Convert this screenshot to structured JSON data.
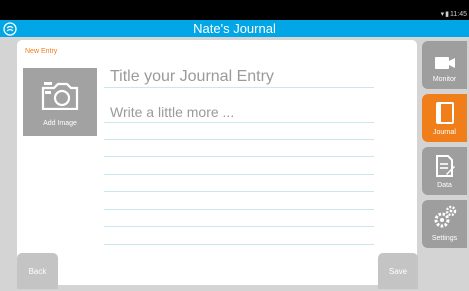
{
  "status_bar": {
    "time": "11:45"
  },
  "app_bar": {
    "title": "Nate's Journal"
  },
  "entry": {
    "heading": "New Entry",
    "add_image_label": "Add Image",
    "title_placeholder": "Title your Journal Entry",
    "body_placeholder": "Write a little more ..."
  },
  "nav": {
    "back_label": "Back",
    "save_label": "Save"
  },
  "sidebar": {
    "items": [
      {
        "label": "Monitor",
        "icon": "camera-icon",
        "active": false
      },
      {
        "label": "Journal",
        "icon": "book-icon",
        "active": true
      },
      {
        "label": "Data",
        "icon": "document-icon",
        "active": false
      },
      {
        "label": "Settings",
        "icon": "gears-icon",
        "active": false
      }
    ]
  },
  "colors": {
    "app_bar": "#00a6e6",
    "accent": "#f07e1a",
    "inactive_tab": "#9e9e9e",
    "ruled_line": "#cbe6f1"
  }
}
